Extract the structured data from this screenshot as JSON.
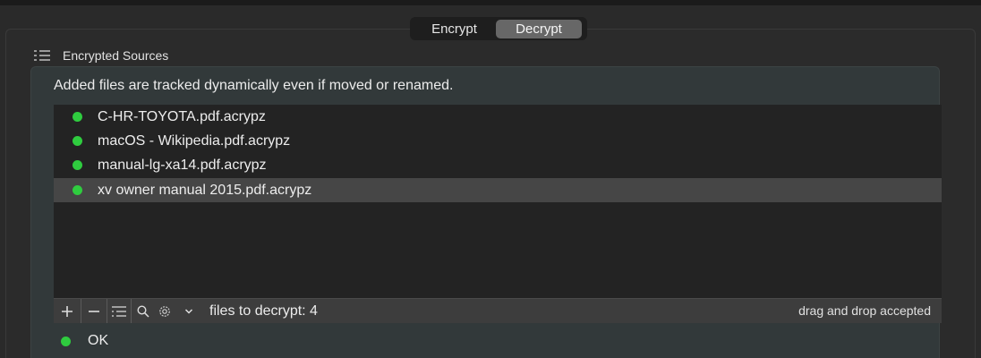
{
  "tabs": {
    "encrypt": "Encrypt",
    "decrypt": "Decrypt",
    "selected": "Decrypt"
  },
  "section": {
    "title": "Encrypted Sources"
  },
  "info_text": "Added files are tracked dynamically  even if moved or renamed.",
  "files": [
    {
      "name": "C-HR-TOYOTA.pdf.acrypz",
      "status_color": "#2fcc3f",
      "selected": false
    },
    {
      "name": "macOS - Wikipedia.pdf.acrypz",
      "status_color": "#2fcc3f",
      "selected": false
    },
    {
      "name": "manual-lg-xa14.pdf.acrypz",
      "status_color": "#2fcc3f",
      "selected": false
    },
    {
      "name": "xv owner manual 2015.pdf.acrypz",
      "status_color": "#2fcc3f",
      "selected": true
    }
  ],
  "toolbar": {
    "add_icon": "plus-icon",
    "remove_icon": "minus-icon",
    "list_icon": "list-icon",
    "search_icon": "search-icon",
    "gear_icon": "gear-icon",
    "dropdown_icon": "chevron-down-icon",
    "count_text": "files to decrypt: 4",
    "hint_text": "drag and drop accepted"
  },
  "status": {
    "text": "OK",
    "color": "#2fcc3f"
  }
}
